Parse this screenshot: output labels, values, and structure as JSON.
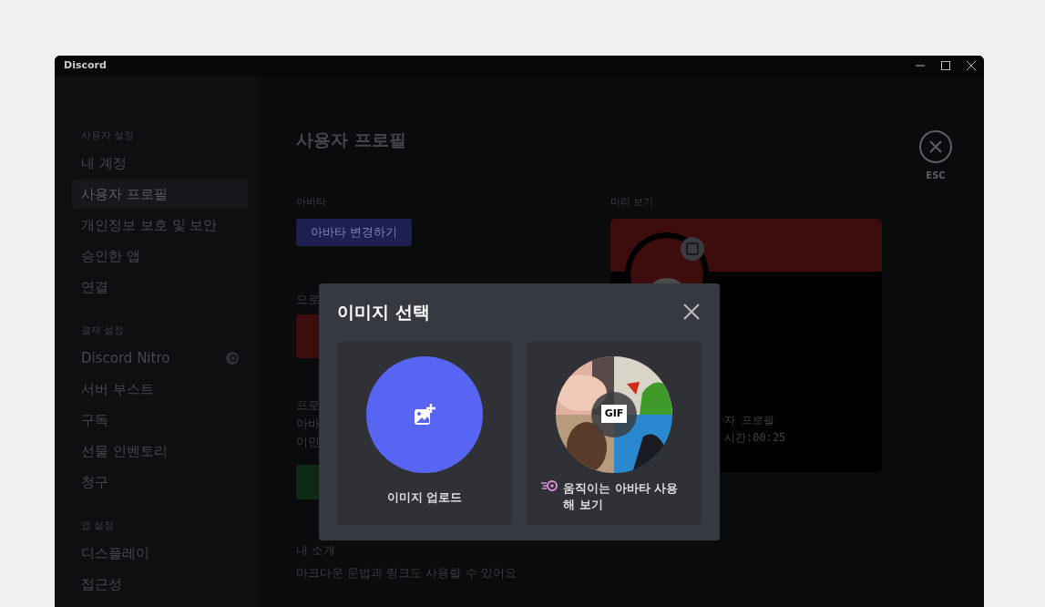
{
  "window": {
    "title": "Discord"
  },
  "sidebar": {
    "sections": [
      {
        "heading": "사용자 설정",
        "items": [
          {
            "label": "내 계정",
            "kind": "plain",
            "selected": false
          },
          {
            "label": "사용자 프로필",
            "kind": "plain",
            "selected": true
          },
          {
            "label": "개인정보 보호 및 보안",
            "kind": "plain",
            "selected": false
          },
          {
            "label": "승인한 앱",
            "kind": "plain",
            "selected": false
          },
          {
            "label": "연결",
            "kind": "plain",
            "selected": false
          }
        ]
      },
      {
        "heading": "결제 설정",
        "items": [
          {
            "label": "Discord Nitro",
            "kind": "nitro",
            "selected": false
          },
          {
            "label": "서버 부스트",
            "kind": "plain",
            "selected": false
          },
          {
            "label": "구독",
            "kind": "plain",
            "selected": false
          },
          {
            "label": "선물 인벤토리",
            "kind": "plain",
            "selected": false
          },
          {
            "label": "청구",
            "kind": "plain",
            "selected": false
          }
        ]
      },
      {
        "heading": "앱 설정",
        "items": [
          {
            "label": "디스플레이",
            "kind": "plain",
            "selected": false
          },
          {
            "label": "접근성",
            "kind": "plain",
            "selected": false
          }
        ]
      }
    ]
  },
  "main": {
    "title": "사용자 프로필",
    "close_label": "ESC",
    "avatar_label": "아바타",
    "avatar_button": "아바타 변경하기",
    "covered": {
      "banner_label": "으로",
      "profile_label": "프로",
      "text_lines": [
        "아바",
        "이민"
      ]
    },
    "preview": {
      "label": "미리 보기",
      "lines": [
        "자 프로필",
        "시간:00:25"
      ]
    },
    "about_label": "내 소개",
    "about_hint": "마크다운 문법과 링크도 사용할 수 있어요"
  },
  "modal": {
    "title": "이미지 선택",
    "options": [
      {
        "kind": "upload",
        "label": "이미지 업로드"
      },
      {
        "kind": "gif",
        "label": "움직이는 아바타 사용해 보기",
        "badge": "GIF"
      }
    ]
  }
}
